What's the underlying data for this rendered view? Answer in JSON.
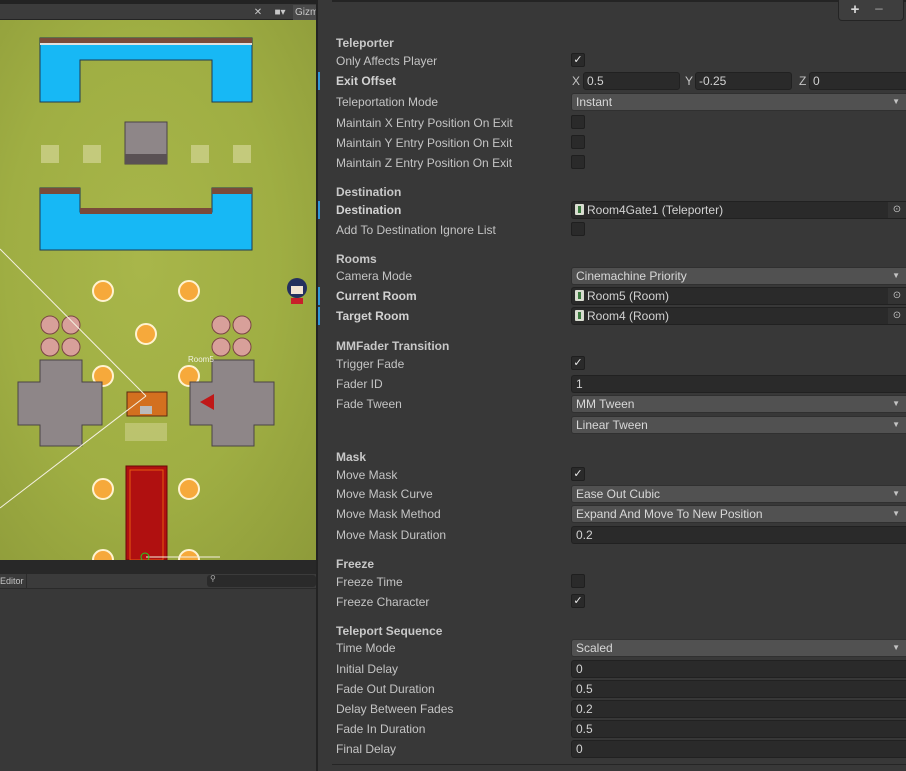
{
  "scene": {
    "toolbar": {
      "tools_icon": "tools-icon",
      "camera_icon": "camera-icon",
      "gizmos_label": "Gizmos"
    },
    "room_label": "Room5",
    "console": {
      "editor_dropdown_label": "Editor",
      "search_placeholder": ""
    }
  },
  "inspector": {
    "list_controls": {
      "add_label": "+",
      "remove_label": "−"
    },
    "sections": {
      "teleporter": {
        "header": "Teleporter",
        "only_affects_player": {
          "label": "Only Affects Player",
          "checked": true
        },
        "exit_offset": {
          "label": "Exit Offset",
          "x_label": "X",
          "x": "0.5",
          "y_label": "Y",
          "y": "-0.25",
          "z_label": "Z",
          "z": "0"
        },
        "teleportation_mode": {
          "label": "Teleportation Mode",
          "value": "Instant"
        },
        "maintain_x": {
          "label": "Maintain X Entry Position On Exit",
          "checked": false
        },
        "maintain_y": {
          "label": "Maintain Y Entry Position On Exit",
          "checked": false
        },
        "maintain_z": {
          "label": "Maintain Z Entry Position On Exit",
          "checked": false
        }
      },
      "destination": {
        "header": "Destination",
        "destination": {
          "label": "Destination",
          "value": "Room4Gate1 (Teleporter)"
        },
        "add_to_ignore": {
          "label": "Add To Destination Ignore List",
          "checked": false
        }
      },
      "rooms": {
        "header": "Rooms",
        "camera_mode": {
          "label": "Camera Mode",
          "value": "Cinemachine Priority"
        },
        "current_room": {
          "label": "Current Room",
          "value": "Room5 (Room)"
        },
        "target_room": {
          "label": "Target Room",
          "value": "Room4 (Room)"
        }
      },
      "mmfader": {
        "header": "MMFader Transition",
        "trigger_fade": {
          "label": "Trigger Fade",
          "checked": true
        },
        "fader_id": {
          "label": "Fader ID",
          "value": "1"
        },
        "fade_tween": {
          "label": "Fade Tween",
          "value": "MM Tween",
          "secondary_value": "Linear Tween"
        }
      },
      "mask": {
        "header": "Mask",
        "move_mask": {
          "label": "Move Mask",
          "checked": true
        },
        "move_mask_curve": {
          "label": "Move Mask Curve",
          "value": "Ease Out Cubic"
        },
        "move_mask_method": {
          "label": "Move Mask Method",
          "value": "Expand And Move To New Position"
        },
        "move_mask_duration": {
          "label": "Move Mask Duration",
          "value": "0.2"
        }
      },
      "freeze": {
        "header": "Freeze",
        "freeze_time": {
          "label": "Freeze Time",
          "checked": false
        },
        "freeze_character": {
          "label": "Freeze Character",
          "checked": true
        }
      },
      "sequence": {
        "header": "Teleport Sequence",
        "time_mode": {
          "label": "Time Mode",
          "value": "Scaled"
        },
        "initial_delay": {
          "label": "Initial Delay",
          "value": "0"
        },
        "fade_out_duration": {
          "label": "Fade Out Duration",
          "value": "0.5"
        },
        "delay_between_fades": {
          "label": "Delay Between Fades",
          "value": "0.2"
        },
        "fade_in_duration": {
          "label": "Fade In Duration",
          "value": "0.5"
        },
        "final_delay": {
          "label": "Final Delay",
          "value": "0"
        }
      }
    }
  },
  "glyphs": {
    "check": "✓",
    "dropdown_arrow": "▼",
    "picker": "⊙",
    "search": "🔍"
  },
  "colors": {
    "override_accent": "#2f95d6",
    "scene_grass": "#a8b64a",
    "water": "#17b8f5",
    "carpet": "#b01010"
  }
}
